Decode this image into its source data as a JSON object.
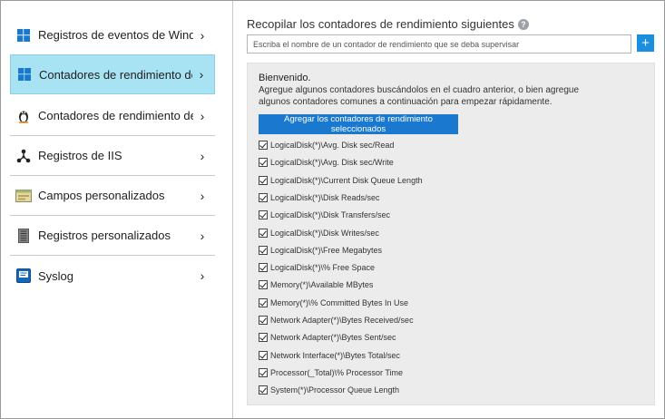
{
  "sidebar": {
    "items": [
      {
        "label": "Registros de eventos de Windows",
        "icon": "windows-logo-icon",
        "active": false
      },
      {
        "label": "Contadores de rendimiento de...",
        "icon": "windows-logo-icon",
        "active": true
      },
      {
        "label": "Contadores de rendimiento de...",
        "icon": "linux-penguin-icon",
        "active": false
      },
      {
        "label": "Registros de IIS",
        "icon": "network-nodes-icon",
        "active": false
      },
      {
        "label": "Campos personalizados",
        "icon": "custom-fields-icon",
        "active": false
      },
      {
        "label": "Registros personalizados",
        "icon": "server-document-icon",
        "active": false
      },
      {
        "label": "Syslog",
        "icon": "syslog-book-icon",
        "active": false
      }
    ],
    "chevron": "›"
  },
  "main": {
    "title": "Recopilar los contadores de rendimiento siguientes",
    "help": "?",
    "search_placeholder": "Escriba el nombre de un contador de rendimiento que se deba supervisar",
    "add_label": "+",
    "welcome_title": "Bienvenido.",
    "welcome_text": "Agregue algunos contadores buscándolos en el cuadro anterior, o bien agregue algunos contadores comunes a continuación para empezar rápidamente.",
    "add_selected_label": "Agregar los contadores de rendimiento seleccionados",
    "counters": [
      {
        "label": "LogicalDisk(*)\\Avg. Disk sec/Read",
        "checked": true
      },
      {
        "label": "LogicalDisk(*)\\Avg. Disk sec/Write",
        "checked": true
      },
      {
        "label": "LogicalDisk(*)\\Current Disk Queue Length",
        "checked": true
      },
      {
        "label": "LogicalDisk(*)\\Disk Reads/sec",
        "checked": true
      },
      {
        "label": "LogicalDisk(*)\\Disk Transfers/sec",
        "checked": true
      },
      {
        "label": "LogicalDisk(*)\\Disk Writes/sec",
        "checked": true
      },
      {
        "label": "LogicalDisk(*)\\Free Megabytes",
        "checked": true
      },
      {
        "label": "LogicalDisk(*)\\% Free Space",
        "checked": true
      },
      {
        "label": "Memory(*)\\Available MBytes",
        "checked": true
      },
      {
        "label": "Memory(*)\\% Committed Bytes In Use",
        "checked": true
      },
      {
        "label": "Network Adapter(*)\\Bytes Received/sec",
        "checked": true
      },
      {
        "label": "Network Adapter(*)\\Bytes Sent/sec",
        "checked": true
      },
      {
        "label": "Network Interface(*)\\Bytes Total/sec",
        "checked": true
      },
      {
        "label": "Processor(_Total)\\% Processor Time",
        "checked": true
      },
      {
        "label": "System(*)\\Processor Queue Length",
        "checked": true
      }
    ]
  },
  "colors": {
    "accent": "#1a79cf",
    "active_item": "#a8e3f3",
    "panel_bg": "#ececec"
  }
}
